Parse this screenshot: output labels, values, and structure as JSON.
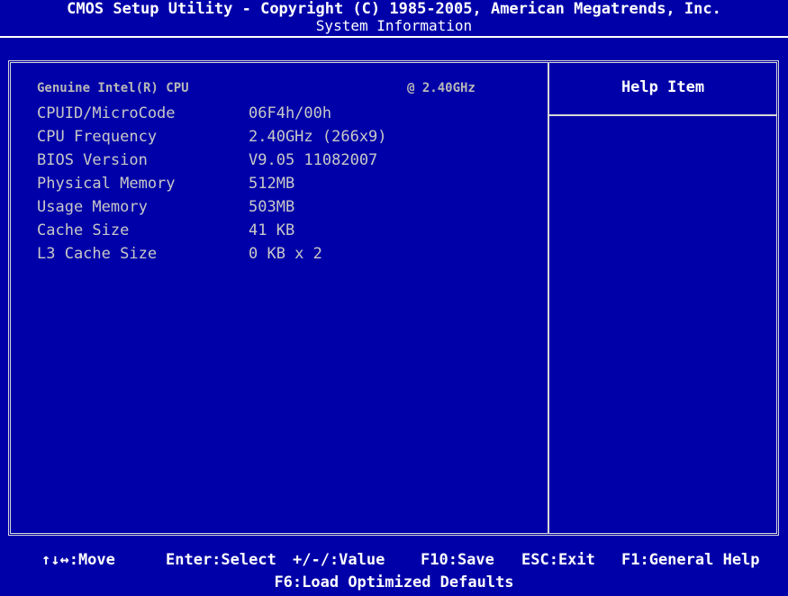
{
  "header": {
    "title": "CMOS Setup Utility - Copyright (C) 1985-2005, American Megatrends, Inc.",
    "subtitle": "System Information"
  },
  "cpu": {
    "name": "Genuine Intel(R) CPU",
    "speed": "@ 2.40GHz"
  },
  "info_rows": [
    {
      "label": "CPUID/MicroCode",
      "value": "06F4h/00h"
    },
    {
      "label": "CPU Frequency",
      "value": "2.40GHz (266x9)"
    },
    {
      "label": "BIOS Version",
      "value": "V9.05 11082007"
    },
    {
      "label": "Physical Memory",
      "value": "512MB"
    },
    {
      "label": "Usage Memory",
      "value": "503MB"
    },
    {
      "label": "Cache Size",
      "value": "41 KB"
    },
    {
      "label": "L3 Cache Size",
      "value": "0 KB x 2"
    }
  ],
  "help": {
    "title": "Help Item"
  },
  "footer": {
    "keys": [
      {
        "text": "↑↓↔:Move"
      },
      {
        "text": "Enter:Select"
      },
      {
        "text": "+/-/:Value"
      },
      {
        "text": "F10:Save"
      },
      {
        "text": "ESC:Exit"
      },
      {
        "text": "F1:General Help"
      }
    ],
    "line2": "F6:Load Optimized Defaults"
  },
  "colors": {
    "background": "#0000a8",
    "text": "#ffffff",
    "dim_text": "#c8c8c8",
    "border": "#d8d8d8"
  }
}
